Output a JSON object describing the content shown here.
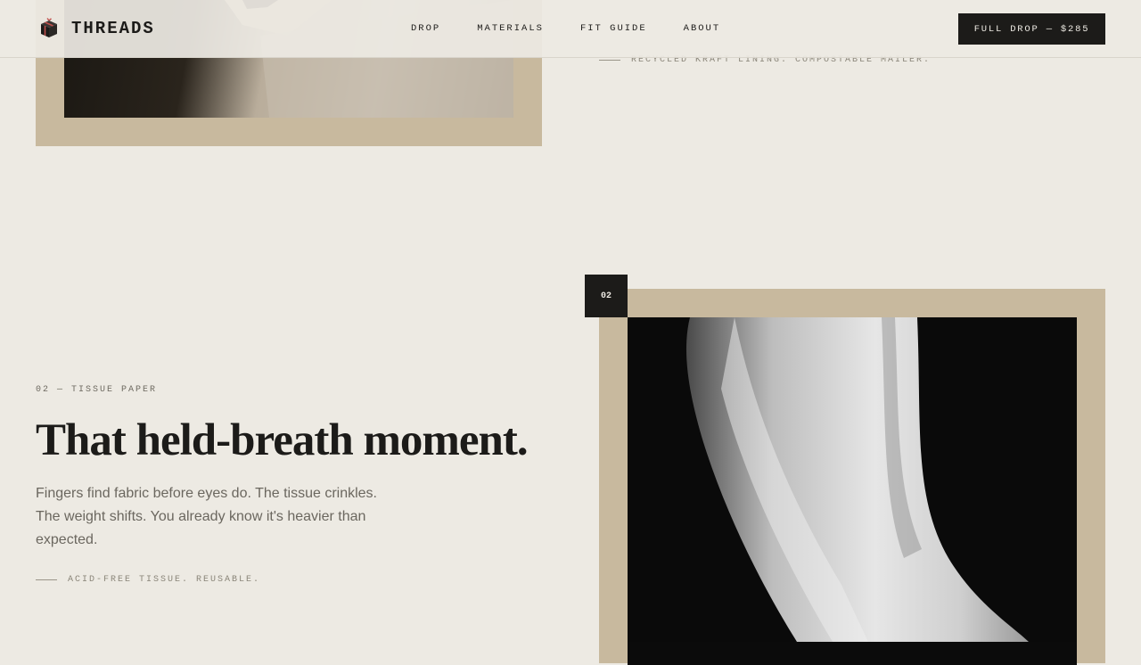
{
  "header": {
    "brand": "THREADS",
    "nav": [
      {
        "label": "DROP"
      },
      {
        "label": "MATERIALS"
      },
      {
        "label": "FIT GUIDE"
      },
      {
        "label": "ABOUT"
      }
    ],
    "cta_label": "FULL DROP — $285"
  },
  "section1": {
    "caption": "RECYCLED KRAFT LINING. COMPOSTABLE MAILER."
  },
  "section2": {
    "badge": "02",
    "eyebrow": "02 — TISSUE PAPER",
    "heading": "That held-breath moment.",
    "body": "Fingers find fabric before eyes do. The tissue crinkles. The weight shifts. You already know it's heavier than expected.",
    "caption": "ACID-FREE TISSUE. REUSABLE."
  },
  "colors": {
    "background": "#edeae3",
    "ink": "#1c1b19",
    "frame": "#c8b99e",
    "muted": "#6b675f",
    "logo_accent": "#c0504d"
  },
  "icons": {
    "logo": "gift-box-icon"
  }
}
